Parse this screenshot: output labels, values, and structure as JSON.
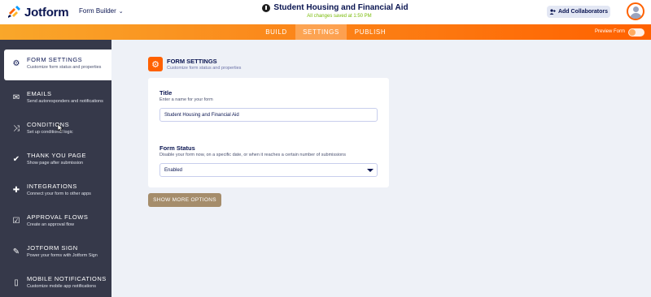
{
  "header": {
    "logo_text": "Jotform",
    "form_builder_label": "Form Builder",
    "form_title": "Student Housing and Financial Aid",
    "saved_status": "All changes saved at 1:50 PM",
    "add_collaborators_label": "Add Collaborators"
  },
  "nav": {
    "tabs": [
      {
        "label": "BUILD"
      },
      {
        "label": "SETTINGS"
      },
      {
        "label": "PUBLISH"
      }
    ],
    "preview_label": "Preview Form"
  },
  "sidebar": {
    "items": [
      {
        "title": "FORM SETTINGS",
        "subtitle": "Customize form status and properties",
        "icon": "gear-icon"
      },
      {
        "title": "EMAILS",
        "subtitle": "Send autoresponders and notifications",
        "icon": "envelope-icon"
      },
      {
        "title": "CONDITIONS",
        "subtitle": "Set up conditional logic",
        "icon": "shuffle-icon"
      },
      {
        "title": "THANK YOU PAGE",
        "subtitle": "Show page after submission",
        "icon": "check-circle-icon"
      },
      {
        "title": "INTEGRATIONS",
        "subtitle": "Connect your form to other apps",
        "icon": "puzzle-icon"
      },
      {
        "title": "APPROVAL FLOWS",
        "subtitle": "Create an approval flow",
        "icon": "approval-icon"
      },
      {
        "title": "JOTFORM SIGN",
        "subtitle": "Power your forms with Jotform Sign",
        "icon": "pen-icon"
      },
      {
        "title": "MOBILE NOTIFICATIONS",
        "subtitle": "Customize mobile app notifications",
        "icon": "mobile-icon"
      }
    ]
  },
  "main": {
    "section_title": "FORM SETTINGS",
    "section_subtitle": "Customize form status and properties",
    "title_label": "Title",
    "title_hint": "Enter a name for your form",
    "title_value": "Student Housing and Financial Aid",
    "status_label": "Form Status",
    "status_hint": "Disable your form now, on a specific date, or when it reaches a certain number of submissions",
    "status_value": "Enabled",
    "more_options_label": "SHOW MORE OPTIONS"
  },
  "colors": {
    "accent": "#ff6100",
    "sidebar_bg": "#36394a",
    "saved_green": "#78bb07",
    "more_button": "#a58d6b"
  }
}
